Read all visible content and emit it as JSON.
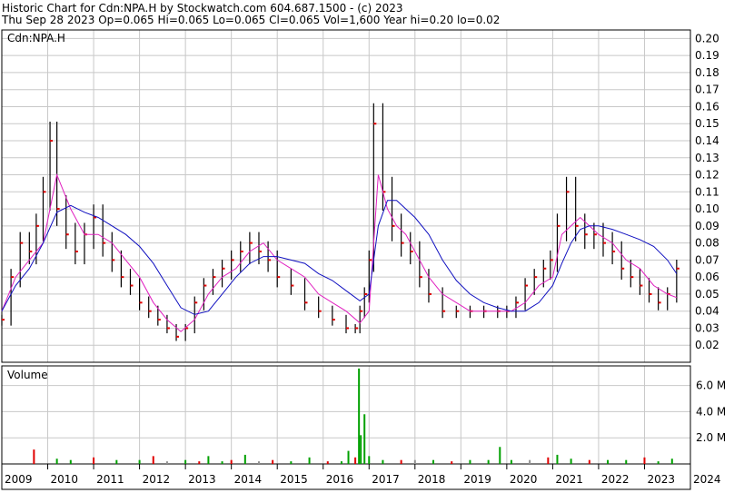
{
  "header": {
    "line1": "Historic Chart for Cdn:NPA.H by Stockwatch.com 604.687.1500 - (c) 2023",
    "line2": "Thu Sep 28 2023  Op=0.065  Hi=0.065  Lo=0.065  Cl=0.065  Vol=1,600  Year hi=0.20  lo=0.02"
  },
  "colors": {
    "grid": "#c8c8c8",
    "price_bar": "#000000",
    "down_tick": "#e00000",
    "ma_short": "#e020c0",
    "ma_long": "#1010c0",
    "volume_up": "#00a000",
    "volume_down": "#e00000",
    "volume_flat": "#909090"
  },
  "chart_data": [
    {
      "type": "line",
      "label": "Cdn:NPA.H",
      "ylim": [
        0.01,
        0.205
      ],
      "y_ticks": [
        "0.20",
        "0.19",
        "0.18",
        "0.17",
        "0.16",
        "0.15",
        "0.14",
        "0.13",
        "0.12",
        "0.11",
        "0.10",
        "0.09",
        "0.08",
        "0.07",
        "0.06",
        "0.05",
        "0.04",
        "0.03",
        "0.02"
      ],
      "x_ticks": [
        "2009",
        "2010",
        "2011",
        "2012",
        "2013",
        "2014",
        "2015",
        "2016",
        "2017",
        "2018",
        "2019",
        "2020",
        "2021",
        "2022",
        "2023",
        "2024"
      ],
      "xlim": [
        2009.0,
        2024.0
      ],
      "series": [
        {
          "x": [
            2009.0,
            2009.2,
            2009.4,
            2009.6,
            2009.75,
            2009.9,
            2010.05,
            2010.2,
            2010.4,
            2010.6,
            2010.8,
            2011.0,
            2011.2,
            2011.4,
            2011.6,
            2011.8,
            2012.0,
            2012.2,
            2012.4,
            2012.6,
            2012.8,
            2013.0,
            2013.2,
            2013.4,
            2013.6,
            2013.8,
            2014.0,
            2014.2,
            2014.4,
            2014.6,
            2014.8,
            2015.0,
            2015.3,
            2015.6,
            2015.9,
            2016.2,
            2016.5,
            2016.7,
            2016.8,
            2016.9,
            2017.0,
            2017.1,
            2017.3,
            2017.5,
            2017.7,
            2017.9,
            2018.1,
            2018.3,
            2018.6,
            2018.9,
            2019.2,
            2019.5,
            2019.8,
            2020.0,
            2020.2,
            2020.4,
            2020.6,
            2020.8,
            2020.95,
            2021.1,
            2021.3,
            2021.5,
            2021.7,
            2021.9,
            2022.1,
            2022.3,
            2022.5,
            2022.7,
            2022.9,
            2023.1,
            2023.3,
            2023.5,
            2023.7
          ],
          "y": [
            0.035,
            0.06,
            0.08,
            0.075,
            0.09,
            0.11,
            0.14,
            0.1,
            0.085,
            0.075,
            0.085,
            0.095,
            0.08,
            0.07,
            0.06,
            0.055,
            0.045,
            0.04,
            0.035,
            0.03,
            0.025,
            0.03,
            0.045,
            0.055,
            0.06,
            0.065,
            0.07,
            0.075,
            0.08,
            0.075,
            0.07,
            0.06,
            0.055,
            0.045,
            0.04,
            0.035,
            0.03,
            0.03,
            0.04,
            0.05,
            0.07,
            0.15,
            0.11,
            0.09,
            0.08,
            0.075,
            0.06,
            0.05,
            0.04,
            0.04,
            0.04,
            0.04,
            0.04,
            0.04,
            0.045,
            0.055,
            0.06,
            0.065,
            0.07,
            0.09,
            0.11,
            0.09,
            0.085,
            0.085,
            0.08,
            0.075,
            0.065,
            0.06,
            0.055,
            0.05,
            0.045,
            0.05,
            0.065
          ]
        },
        {
          "x": [
            2009.0,
            2009.3,
            2009.6,
            2009.9,
            2010.2,
            2010.5,
            2010.8,
            2011.1,
            2011.4,
            2011.7,
            2012.0,
            2012.3,
            2012.6,
            2012.9,
            2013.2,
            2013.5,
            2013.8,
            2014.1,
            2014.4,
            2014.7,
            2015.0,
            2015.3,
            2015.6,
            2015.9,
            2016.2,
            2016.5,
            2016.8,
            2017.0,
            2017.2,
            2017.4,
            2017.6,
            2017.8,
            2018.0,
            2018.3,
            2018.6,
            2018.9,
            2019.2,
            2019.5,
            2019.8,
            2020.1,
            2020.4,
            2020.7,
            2021.0,
            2021.2,
            2021.4,
            2021.6,
            2021.8,
            2022.0,
            2022.3,
            2022.6,
            2022.9,
            2023.2,
            2023.5,
            2023.7
          ],
          "y": [
            0.04,
            0.06,
            0.07,
            0.08,
            0.12,
            0.1,
            0.085,
            0.085,
            0.08,
            0.07,
            0.06,
            0.045,
            0.035,
            0.028,
            0.035,
            0.05,
            0.06,
            0.065,
            0.075,
            0.08,
            0.07,
            0.065,
            0.06,
            0.05,
            0.045,
            0.04,
            0.033,
            0.04,
            0.12,
            0.1,
            0.09,
            0.085,
            0.075,
            0.06,
            0.05,
            0.045,
            0.04,
            0.04,
            0.04,
            0.04,
            0.045,
            0.055,
            0.06,
            0.085,
            0.09,
            0.095,
            0.09,
            0.085,
            0.08,
            0.07,
            0.065,
            0.055,
            0.05,
            0.048
          ]
        },
        {
          "x": [
            2009.0,
            2009.3,
            2009.6,
            2009.9,
            2010.2,
            2010.5,
            2010.8,
            2011.1,
            2011.4,
            2011.7,
            2012.0,
            2012.3,
            2012.6,
            2012.9,
            2013.2,
            2013.5,
            2013.8,
            2014.1,
            2014.4,
            2014.7,
            2015.0,
            2015.3,
            2015.6,
            2015.9,
            2016.2,
            2016.5,
            2016.8,
            2017.0,
            2017.2,
            2017.4,
            2017.6,
            2017.8,
            2018.0,
            2018.3,
            2018.6,
            2018.9,
            2019.2,
            2019.5,
            2019.8,
            2020.1,
            2020.4,
            2020.7,
            2021.0,
            2021.2,
            2021.4,
            2021.6,
            2021.8,
            2022.0,
            2022.3,
            2022.6,
            2022.9,
            2023.2,
            2023.5,
            2023.7
          ],
          "y": [
            0.04,
            0.055,
            0.065,
            0.08,
            0.098,
            0.102,
            0.098,
            0.095,
            0.09,
            0.085,
            0.078,
            0.068,
            0.055,
            0.042,
            0.038,
            0.04,
            0.05,
            0.06,
            0.068,
            0.072,
            0.072,
            0.07,
            0.068,
            0.062,
            0.058,
            0.052,
            0.046,
            0.05,
            0.09,
            0.105,
            0.105,
            0.1,
            0.095,
            0.085,
            0.07,
            0.058,
            0.05,
            0.045,
            0.042,
            0.04,
            0.04,
            0.045,
            0.055,
            0.068,
            0.08,
            0.088,
            0.09,
            0.09,
            0.088,
            0.085,
            0.082,
            0.078,
            0.07,
            0.062
          ]
        }
      ]
    },
    {
      "type": "bar",
      "label": "Volume",
      "ylim": [
        0,
        7.5
      ],
      "y_ticks": [
        "6.0 M",
        "4.0 M",
        "2.0 M"
      ],
      "x": [
        2009.7,
        2010.2,
        2010.5,
        2011.0,
        2011.5,
        2012.0,
        2012.3,
        2012.6,
        2013.0,
        2013.3,
        2013.5,
        2013.8,
        2014.0,
        2014.3,
        2014.6,
        2014.9,
        2015.3,
        2015.7,
        2016.1,
        2016.4,
        2016.55,
        2016.7,
        2016.78,
        2016.82,
        2016.9,
        2017.0,
        2017.3,
        2017.7,
        2018.0,
        2018.4,
        2018.8,
        2019.2,
        2019.6,
        2019.85,
        2020.1,
        2020.5,
        2020.9,
        2021.1,
        2021.4,
        2021.8,
        2022.2,
        2022.6,
        2023.0,
        2023.3,
        2023.6
      ],
      "values": [
        1.1,
        0.4,
        0.3,
        0.5,
        0.3,
        0.3,
        0.6,
        0.2,
        0.3,
        0.2,
        0.6,
        0.2,
        0.3,
        0.7,
        0.2,
        0.3,
        0.2,
        0.5,
        0.2,
        0.2,
        1.0,
        0.5,
        7.3,
        2.2,
        3.8,
        0.6,
        0.3,
        0.3,
        0.3,
        0.3,
        0.2,
        0.3,
        0.3,
        1.3,
        0.3,
        0.3,
        0.5,
        0.7,
        0.4,
        0.3,
        0.3,
        0.3,
        0.5,
        0.2,
        0.4
      ]
    }
  ]
}
